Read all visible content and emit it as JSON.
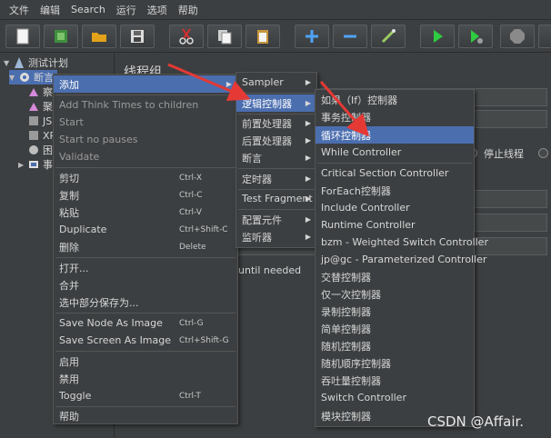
{
  "menubar": [
    "文件",
    "编辑",
    "Search",
    "运行",
    "选项",
    "帮助"
  ],
  "tree": {
    "root": "测试计划",
    "thread_group": "断言",
    "children": [
      "察",
      "聚",
      "JS",
      "XP",
      "困",
      "事"
    ]
  },
  "panel": {
    "title": "线程组",
    "stop_thread": "停止线程",
    "until_needed": "until needed"
  },
  "context_menu": [
    {
      "label": "添加",
      "submenu": true,
      "selected": true
    },
    {
      "label": "Add Think Times to children"
    },
    {
      "label": "Start"
    },
    {
      "label": "Start no pauses"
    },
    {
      "label": "Validate"
    },
    {
      "label": "剪切",
      "shortcut": "Ctrl-X"
    },
    {
      "label": "复制",
      "shortcut": "Ctrl-C"
    },
    {
      "label": "粘贴",
      "shortcut": "Ctrl-V"
    },
    {
      "label": "Duplicate",
      "shortcut": "Ctrl+Shift-C"
    },
    {
      "label": "删除",
      "shortcut": "Delete"
    },
    {
      "label": "打开..."
    },
    {
      "label": "合并"
    },
    {
      "label": "选中部分保存为..."
    },
    {
      "label": "Save Node As Image",
      "shortcut": "Ctrl-G"
    },
    {
      "label": "Save Screen As Image",
      "shortcut": "Ctrl+Shift-G"
    },
    {
      "label": "启用"
    },
    {
      "label": "禁用"
    },
    {
      "label": "Toggle",
      "shortcut": "Ctrl-T"
    },
    {
      "label": "帮助"
    }
  ],
  "add_submenu": [
    {
      "label": "Sampler"
    },
    {
      "label": "逻辑控制器",
      "selected": true
    },
    {
      "label": "前置处理器"
    },
    {
      "label": "后置处理器"
    },
    {
      "label": "断言"
    },
    {
      "label": "定时器"
    },
    {
      "label": "Test Fragment"
    },
    {
      "label": "配置元件"
    },
    {
      "label": "监听器"
    }
  ],
  "logic_submenu": [
    "如果（If）控制器",
    "事务控制器",
    "循环控制器",
    "While Controller",
    "Critical Section Controller",
    "ForEach控制器",
    "Include Controller",
    "Runtime Controller",
    "bzm - Weighted Switch Controller",
    "jp@gc - Parameterized Controller",
    "交替控制器",
    "仅一次控制器",
    "录制控制器",
    "简单控制器",
    "随机控制器",
    "随机顺序控制器",
    "吞吐量控制器",
    "Switch Controller",
    "模块控制器"
  ],
  "watermark": "CSDN @Affair.",
  "colors": {
    "background": "#3c3f41",
    "selection": "#4b6eaf",
    "annotation_arrow": "#e53935"
  }
}
